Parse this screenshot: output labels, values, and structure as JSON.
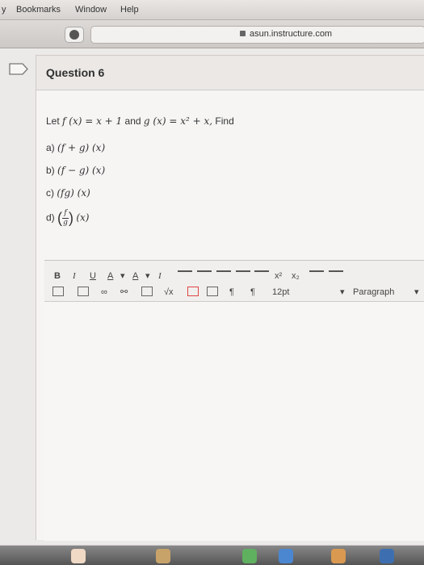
{
  "menubar": {
    "items": [
      "y",
      "Bookmarks",
      "Window",
      "Help"
    ]
  },
  "browser": {
    "url": "asun.instructure.com"
  },
  "question": {
    "title": "Question 6",
    "prompt_prefix": "Let",
    "f_def": "f (x) = x + 1",
    "and": "and",
    "g_def": "g (x) = x² + x,",
    "find": "Find",
    "parts": [
      {
        "label": "a)",
        "expr": "(f + g) (x)"
      },
      {
        "label": "b)",
        "expr": "(f − g) (x)"
      },
      {
        "label": "c)",
        "expr": "(fg) (x)"
      },
      {
        "label": "d)",
        "num": "f",
        "den": "g",
        "expr": "(x)"
      }
    ]
  },
  "editor": {
    "bold": "B",
    "italic": "I",
    "underline": "U",
    "text_color": "A",
    "bg_color": "A",
    "clear_format": "I",
    "superscript": "x²",
    "subscript": "x₂",
    "font_size": "12pt",
    "block_format": "Paragraph",
    "sqrt": "√x"
  }
}
